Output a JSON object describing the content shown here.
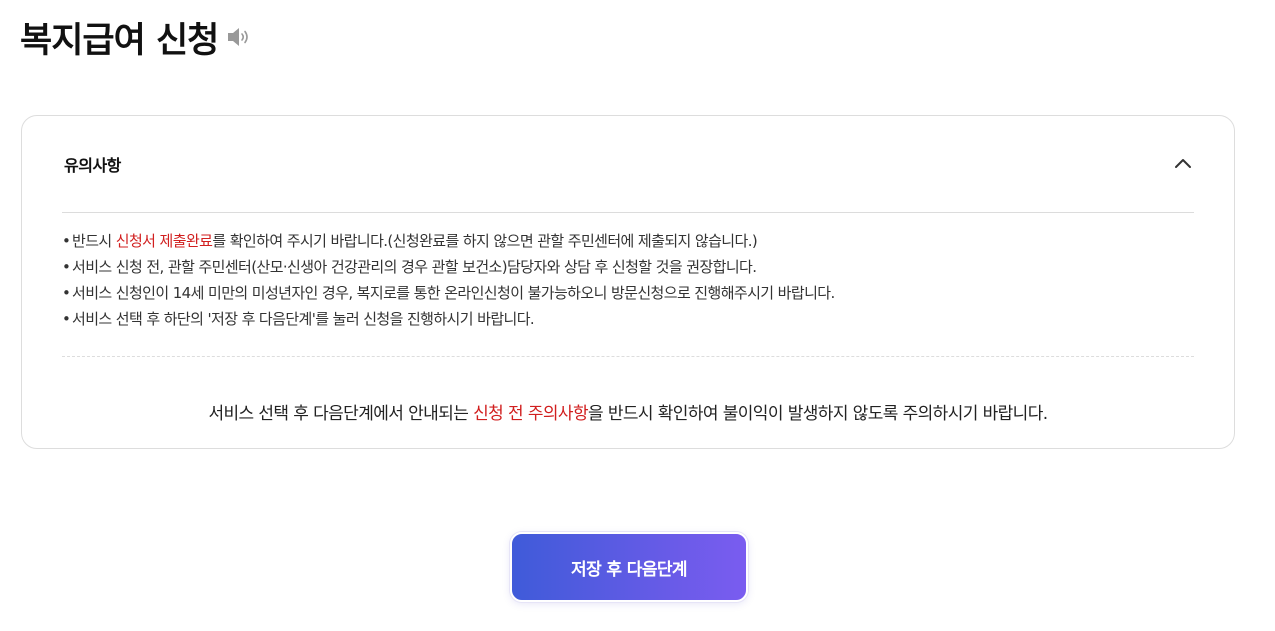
{
  "page": {
    "title": "복지급여 신청",
    "speaker_icon": "speaker-icon"
  },
  "notice": {
    "heading": "유의사항",
    "toggle_icon": "chevron-up-icon",
    "items": [
      {
        "bullet": "•",
        "before": "반드시 ",
        "highlight": "신청서 제출완료",
        "after": "를 확인하여 주시기 바랍니다.(신청완료를 하지 않으면 관할 주민센터에 제출되지 않습니다.)"
      },
      {
        "bullet": "•",
        "text": "서비스 신청 전, 관할 주민센터(산모·신생아 건강관리의 경우 관할 보건소)담당자와 상담 후 신청할 것을 권장합니다."
      },
      {
        "bullet": "•",
        "text": "서비스 신청인이 14세 미만의 미성년자인 경우, 복지로를 통한 온라인신청이 불가능하오니 방문신청으로 진행해주시기 바랍니다."
      },
      {
        "bullet": "•",
        "text": "서비스 선택 후 하단의 '저장 후 다음단계'를 눌러 신청을 진행하시기 바랍니다."
      }
    ],
    "summary": {
      "before": "서비스 선택 후 다음단계에서 안내되는 ",
      "highlight": "신청 전 주의사항",
      "after": "을 반드시 확인하여 불이익이 발생하지 않도록 주의하시기 바랍니다."
    }
  },
  "actions": {
    "next_label": "저장 후 다음단계"
  },
  "colors": {
    "highlight": "#d11f1f",
    "button_gradient_start": "#3f5bd9",
    "button_gradient_end": "#7a5cf0"
  }
}
